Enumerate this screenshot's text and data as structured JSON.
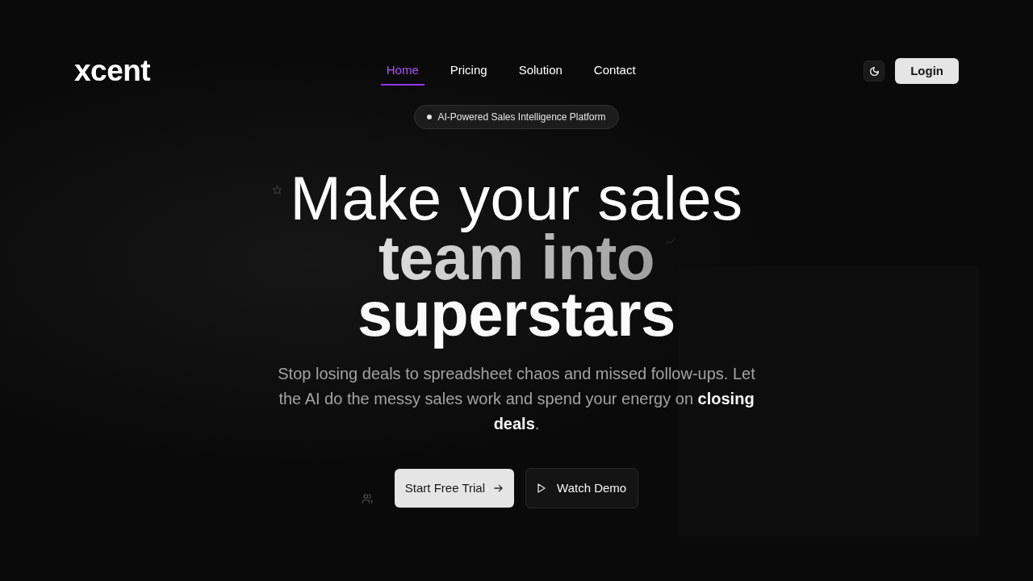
{
  "header": {
    "logo": "xcent",
    "nav": [
      {
        "label": "Home",
        "selected": true
      },
      {
        "label": "Pricing",
        "selected": false
      },
      {
        "label": "Solution",
        "selected": false
      },
      {
        "label": "Contact",
        "selected": false
      }
    ],
    "login_button": "Login"
  },
  "hero": {
    "badge": "AI-Powered Sales Intelligence Platform",
    "headline": [
      {
        "text": "Make your sales",
        "kind": "light"
      },
      {
        "text": "team into",
        "kind": "muted"
      },
      {
        "text": "superstars",
        "kind": "bold"
      }
    ],
    "subtitle": "Stop losing deals to spreadsheet chaos and missed follow-ups. Let the AI do the messy sales work and spend your energy on **closing deals**.",
    "buttons": [
      {
        "label": "Start Free Trial",
        "kind": "primary"
      },
      {
        "label": "Watch Demo",
        "kind": "secondary"
      }
    ]
  }
}
